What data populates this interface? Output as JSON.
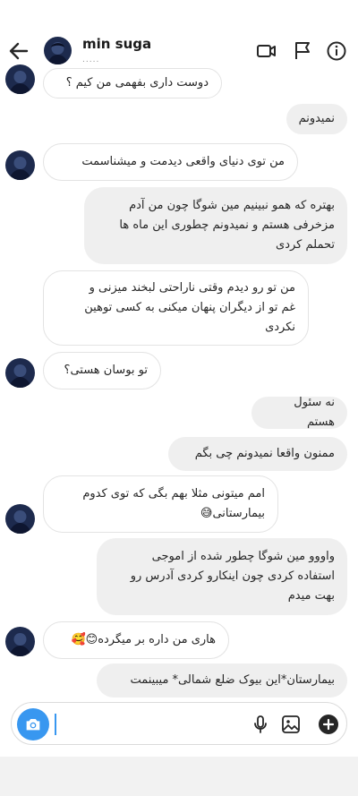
{
  "header": {
    "name": "min suga",
    "subtitle": "....."
  },
  "messages": [
    {
      "from": "them",
      "text": "دوست داری بفهمی من کیم ؟"
    },
    {
      "from": "me",
      "text": "نمیدونم"
    },
    {
      "from": "them",
      "text": "من توی دنیای واقعی دیدمت و میشناسمت"
    },
    {
      "from": "me",
      "text": "بهتره که همو نبینیم مین شوگا چون من آدم\nمزخرفی هستم و نمیدونم چطوری این ماه ها\nتحملم کردی"
    },
    {
      "from": "them",
      "text": "من تو رو دیدم وقتی ناراحتی لبخند میزنی و\nغم تو از دیگران پنهان میکنی به کسی توهین\nنکردی"
    },
    {
      "from": "them",
      "text": "تو بوسان هستی؟"
    },
    {
      "from": "me",
      "text": "نه سئول هستم"
    },
    {
      "from": "me",
      "text": "ممنون واقعا نمیدونم چی بگم"
    },
    {
      "from": "them",
      "text": "امم میتونی مثلا بهم بگی که توی کدوم\nبیمارستانی😅"
    },
    {
      "from": "me",
      "text": "واووو مین شوگا چطور شده از اموجی\nاستفاده کردی چون اینکارو کردی آدرس رو\nبهت میدم"
    },
    {
      "from": "them",
      "text": "هاری من داره بر میگرده😊🥰"
    },
    {
      "from": "me",
      "text": "بیمارستان*این بیوک ضلع شمالی* میبینمت"
    }
  ],
  "composer": {
    "placeholder": ""
  },
  "icons": {
    "back": "arrow-left-icon",
    "video": "video-call-icon",
    "flag": "flag-icon",
    "info": "info-icon",
    "camera": "camera-icon",
    "mic": "microphone-icon",
    "gallery": "gallery-icon",
    "plus": "plus-icon"
  },
  "colors": {
    "accent": "#3897f0",
    "outgoing_bubble": "#efefef",
    "incoming_border": "#e3e3e3"
  }
}
